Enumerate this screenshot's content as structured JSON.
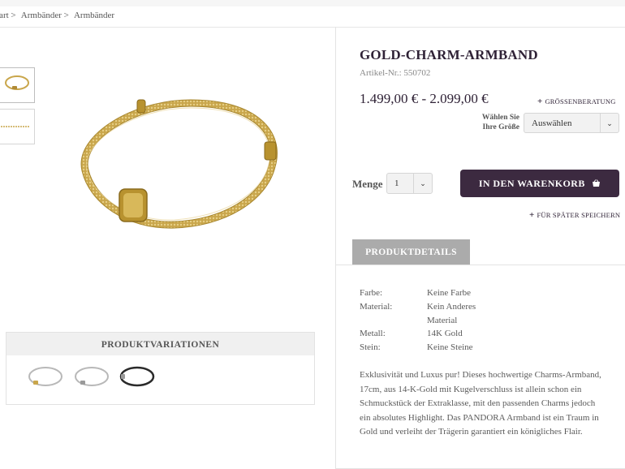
{
  "breadcrumb": [
    "tart >",
    "Armbänder >",
    "Armbänder"
  ],
  "product": {
    "title": "GOLD-CHARM-ARMBAND",
    "article": "Artikel-Nr.: 550702",
    "price": "1.499,00 € - 2.099,00 €",
    "size_advice": "GRÖSSENBERATUNG",
    "size_label_1": "Wählen Sie",
    "size_label_2": "Ihre Größe",
    "size_select": "Auswählen",
    "qty_label": "Menge",
    "qty_value": "1",
    "cart_button": "IN DEN WARENKORB",
    "save_later": "FÜR SPÄTER SPEICHERN",
    "tab_details": "PRODUKTDETAILS"
  },
  "specs": [
    {
      "key": "Farbe:",
      "value": "Keine Farbe"
    },
    {
      "key": "Material:",
      "value": "Kein Anderes Material"
    },
    {
      "key": "Metall:",
      "value": "14K Gold"
    },
    {
      "key": "Stein:",
      "value": "Keine Steine"
    }
  ],
  "description": "Exklusivität und Luxus pur! Dieses hochwertige Charms-Armband, 17cm, aus 14-K-Gold mit Kugelverschluss ist allein schon ein Schmuckstück der Extraklasse, mit den passenden Charms jedoch ein absolutes Highlight. Das PANDORA Armband ist ein Traum in Gold und verleiht der Trägerin garantiert ein königliches Flair.",
  "variations": {
    "title": "PRODUKTVARIATIONEN"
  },
  "colors": {
    "accent": "#3c2a40",
    "tab": "#ababab",
    "gold": "#c9a64b",
    "silver": "#b8b8b8",
    "leather": "#2a2a2a"
  }
}
